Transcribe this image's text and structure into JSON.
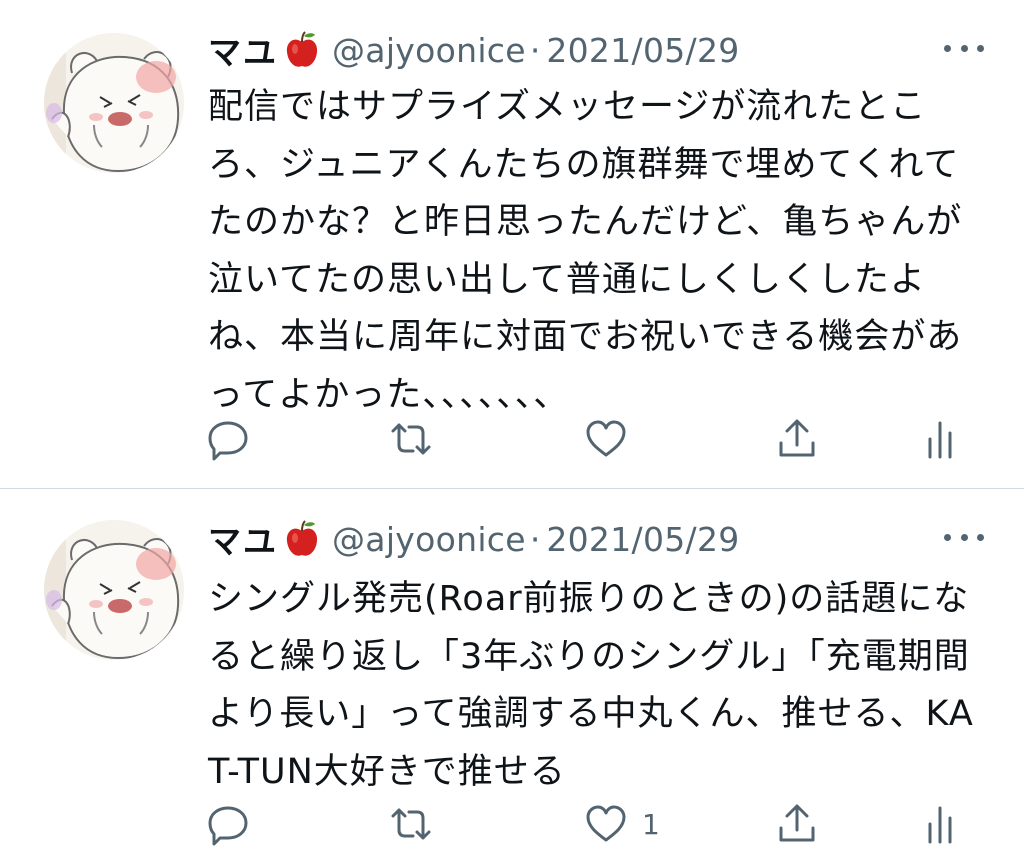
{
  "colors": {
    "text": "#0f1419",
    "secondary": "#536471",
    "divider": "#cfd9de",
    "apple": "#d4201f"
  },
  "tweets": [
    {
      "name": "マユ",
      "name_emoji": "apple-icon",
      "handle": "@ajyoonice",
      "separator": "·",
      "date": "2021/05/29",
      "text": "配信ではサプライズメッセージが流れたところ、ジュニアくんたちの旗群舞で埋めてくれてたのかな？と昨日思ったんだけど、亀ちゃんが泣いてたの思い出して普通にしくしくしたよね、本当に周年に対面でお祝いできる機会があってよかった、、、、、、、",
      "like_count": ""
    },
    {
      "name": "マユ",
      "name_emoji": "apple-icon",
      "handle": "@ajyoonice",
      "separator": "·",
      "date": "2021/05/29",
      "text": "シングル発売(Roar前振りのときの)の話題になると繰り返し「3年ぶりのシングル」「充電期間より長い」って強調する中丸くん、推せる、KAT-TUN大好きで推せる",
      "like_count": "1"
    }
  ]
}
